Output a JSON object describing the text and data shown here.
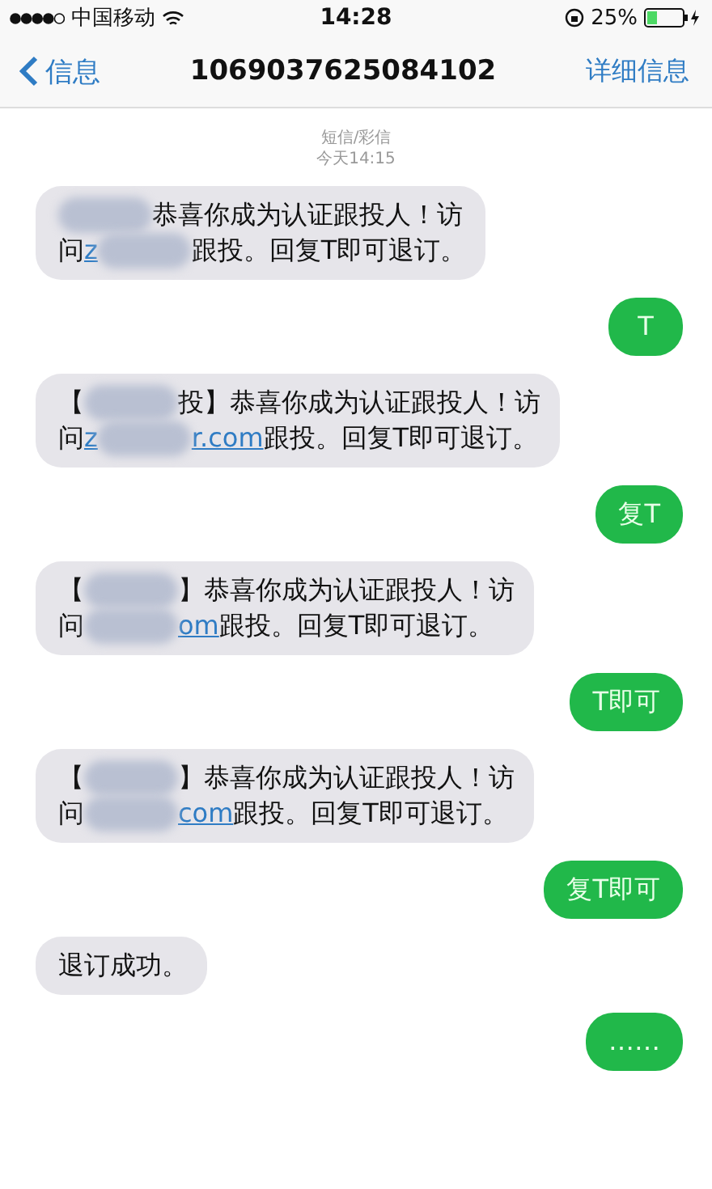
{
  "status_bar": {
    "carrier": "中国移动",
    "time": "14:28",
    "battery": "25%"
  },
  "nav": {
    "back": "信息",
    "title": "1069037625084102",
    "action": "详细信息"
  },
  "header": {
    "service": "短信/彩信",
    "timestamp": "今天14:15"
  },
  "messages": [
    {
      "kind": "incoming",
      "lines": [
        [
          {
            "kind": "redacted"
          },
          {
            "kind": "text",
            "text": "恭喜你成为认证跟投人！访"
          }
        ],
        [
          {
            "kind": "text",
            "text": "问 "
          },
          {
            "kind": "link",
            "text": "z"
          },
          {
            "kind": "redacted"
          },
          {
            "kind": "text",
            "text": "跟投。回复T即可退订。"
          }
        ]
      ]
    },
    {
      "kind": "outgoing",
      "text": "T"
    },
    {
      "kind": "incoming",
      "lines": [
        [
          {
            "kind": "text",
            "text": "【"
          },
          {
            "kind": "redacted"
          },
          {
            "kind": "text",
            "text": "投】恭喜你成为认证跟投人！访"
          }
        ],
        [
          {
            "kind": "text",
            "text": "问 "
          },
          {
            "kind": "link",
            "text": "z"
          },
          {
            "kind": "redacted"
          },
          {
            "kind": "link",
            "text": "r.com"
          },
          {
            "kind": "text",
            "text": "跟投。回复T即可退订。"
          }
        ]
      ]
    },
    {
      "kind": "outgoing",
      "text": "复T"
    },
    {
      "kind": "incoming",
      "lines": [
        [
          {
            "kind": "text",
            "text": "【"
          },
          {
            "kind": "redacted"
          },
          {
            "kind": "text",
            "text": "】恭喜你成为认证跟投人！访"
          }
        ],
        [
          {
            "kind": "text",
            "text": "问 "
          },
          {
            "kind": "redacted"
          },
          {
            "kind": "link",
            "text": "om"
          },
          {
            "kind": "text",
            "text": "跟投。回复T即可退订。"
          }
        ]
      ]
    },
    {
      "kind": "outgoing",
      "text": "T即可"
    },
    {
      "kind": "incoming",
      "lines": [
        [
          {
            "kind": "text",
            "text": "【"
          },
          {
            "kind": "redacted"
          },
          {
            "kind": "text",
            "text": "】恭喜你成为认证跟投人！访"
          }
        ],
        [
          {
            "kind": "text",
            "text": "问 "
          },
          {
            "kind": "redacted"
          },
          {
            "kind": "link",
            "text": "com"
          },
          {
            "kind": "text",
            "text": "跟投。回复T即可退订。"
          }
        ]
      ]
    },
    {
      "kind": "outgoing",
      "text": "复T即可"
    },
    {
      "kind": "incoming",
      "lines": [
        [
          {
            "kind": "text",
            "text": "退订成功。"
          }
        ]
      ]
    },
    {
      "kind": "outgoing",
      "text": "……"
    }
  ]
}
